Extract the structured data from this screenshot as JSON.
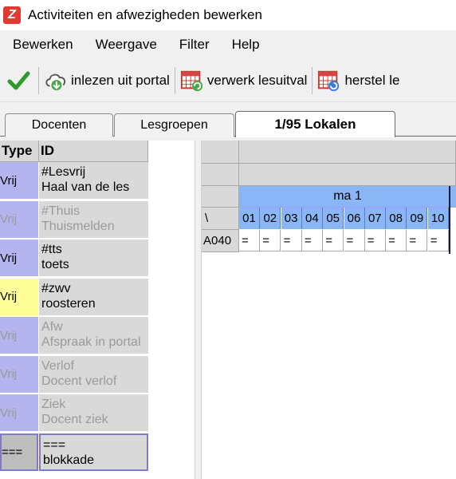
{
  "window": {
    "title": "Activiteiten en afwezigheden bewerken",
    "icon": "app-z-icon"
  },
  "menu": [
    "Bewerken",
    "Weergave",
    "Filter",
    "Help"
  ],
  "toolbar": {
    "confirm_icon": "checkmark-icon",
    "import_label": "inlezen uit portal",
    "process_label": "verwerk lesuitval",
    "restore_label": "herstel le"
  },
  "tabs": [
    "Docenten",
    "Lesgroepen",
    "1/95 Lokalen"
  ],
  "left_table": {
    "headers": {
      "type": "Type",
      "id": "ID"
    },
    "rows": [
      {
        "type": "Vrij",
        "code": "#Lesvrij",
        "desc": "Haal van de les",
        "type_color": "#b4b4ee",
        "dimmed": false
      },
      {
        "type": "Vrij",
        "code": "#Thuis",
        "desc": "Thuismelden",
        "type_color": "#b4b4ee",
        "dimmed": true
      },
      {
        "type": "Vrij",
        "code": "#tts",
        "desc": "toets",
        "type_color": "#b4b4ee",
        "dimmed": false
      },
      {
        "type": "Vrij",
        "code": "#zwv",
        "desc": "roosteren",
        "type_color": "#ffff99",
        "dimmed": false
      },
      {
        "type": "Vrij",
        "code": "Afw",
        "desc": "Afspraak in portal",
        "type_color": "#b4b4ee",
        "dimmed": true
      },
      {
        "type": "Vrij",
        "code": "Verlof",
        "desc": "Docent verlof",
        "type_color": "#b4b4ee",
        "dimmed": true
      },
      {
        "type": "Vrij",
        "code": "Ziek",
        "desc": "Docent ziek",
        "type_color": "#b4b4ee",
        "dimmed": true
      },
      {
        "type": "===",
        "code": "===",
        "desc": "blokkade",
        "type_color": "#bdbdbd",
        "dimmed": false
      }
    ]
  },
  "grid": {
    "day": "ma 1",
    "corner": "\\",
    "slots": [
      "01",
      "02",
      "03",
      "04",
      "05",
      "06",
      "07",
      "08",
      "09",
      "10"
    ],
    "row_label": "A040",
    "cell_value": "=",
    "highlight_color": "#8ab6f5"
  }
}
